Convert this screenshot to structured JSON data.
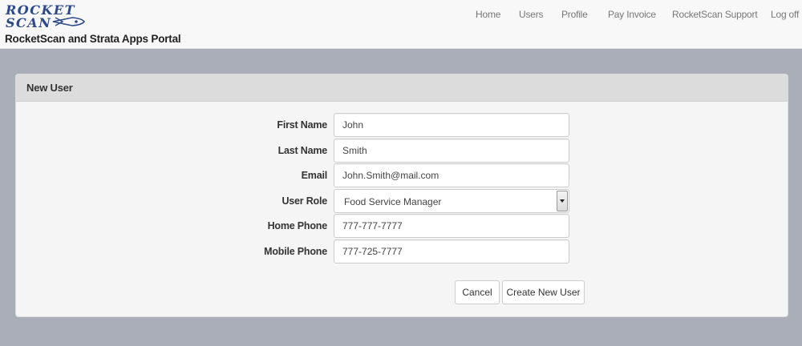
{
  "header": {
    "logo": {
      "line1": "ROCKET",
      "line2": "SCAN",
      "icon": "rocket-icon"
    },
    "portal_title": "RocketScan and Strata Apps Portal",
    "nav": [
      "Home",
      "Users",
      "Profile",
      "Pay Invoice",
      "RocketScan Support",
      "Log off"
    ]
  },
  "panel": {
    "title": "New User"
  },
  "form": {
    "first_name": {
      "label": "First Name",
      "value": "John"
    },
    "last_name": {
      "label": "Last Name",
      "value": "Smith"
    },
    "email": {
      "label": "Email",
      "value": "John.Smith@mail.com"
    },
    "user_role": {
      "label": "User Role",
      "value": "Food Service Manager"
    },
    "home_phone": {
      "label": "Home Phone",
      "value": "777-777-7777"
    },
    "mobile_phone": {
      "label": "Mobile Phone",
      "value": "777-725-7777"
    }
  },
  "buttons": {
    "cancel": "Cancel",
    "create": "Create New User"
  },
  "colors": {
    "logo": "#2a4a8a",
    "page_background": "#a9aeb8",
    "panel_heading": "#dcdcdc"
  }
}
